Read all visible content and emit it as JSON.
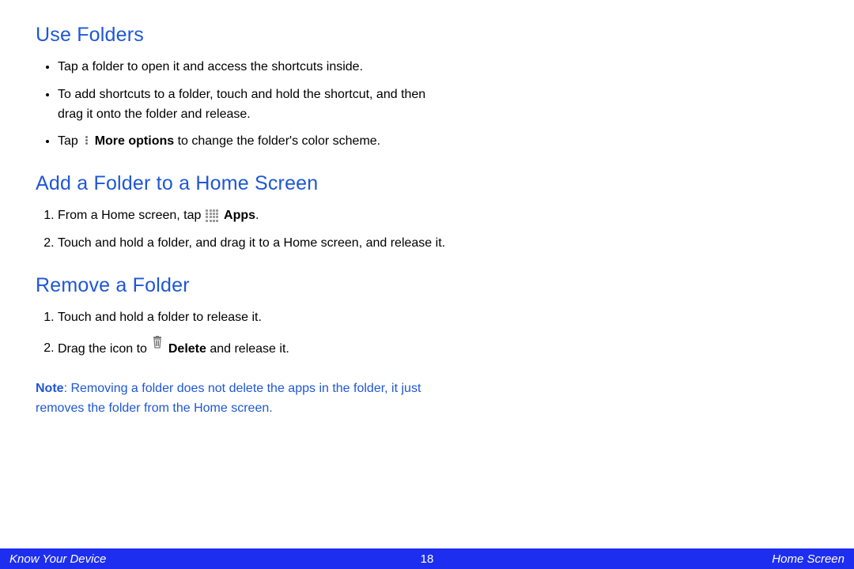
{
  "sections": [
    {
      "heading": "Use Folders",
      "type": "bullets",
      "items": [
        {
          "text": "Tap a folder to open it and access the shortcuts inside."
        },
        {
          "text": "To add shortcuts to a folder, touch and hold the shortcut, and then drag it onto the folder and release."
        },
        {
          "pre": "Tap ",
          "icon": "more",
          "bold": "More options",
          "post": " to change the folder's color scheme."
        }
      ]
    },
    {
      "heading": "Add a Folder to a Home Screen",
      "type": "steps",
      "items": [
        {
          "pre": "From a Home screen, tap ",
          "icon": "apps",
          "bold": "Apps",
          "post": "."
        },
        {
          "text": "Touch and hold a folder, and drag it to a Home screen, and release it."
        }
      ]
    },
    {
      "heading": "Remove a Folder",
      "type": "steps",
      "items": [
        {
          "text": "Touch and hold a folder to release it."
        },
        {
          "pre": "Drag the icon to ",
          "icon": "trash",
          "bold": "Delete",
          "post": " and release it."
        }
      ]
    }
  ],
  "note": {
    "label": "Note",
    "text": ": Removing a folder does not delete the apps in the folder, it just removes the folder from the Home screen."
  },
  "footer": {
    "left": "Know Your Device",
    "center": "18",
    "right": "Home Screen"
  }
}
